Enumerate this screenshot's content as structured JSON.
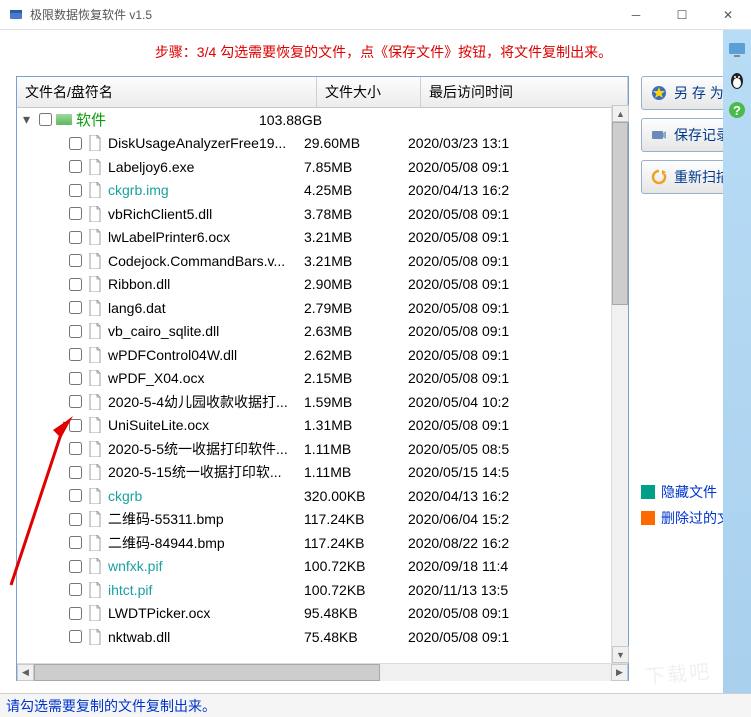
{
  "title": "极限数据恢复软件 v1.5",
  "step_text": "步骤：3/4 勾选需要恢复的文件，点《保存文件》按钮，将文件复制出来。",
  "columns": {
    "name": "文件名/盘符名",
    "size": "文件大小",
    "date": "最后访问时间"
  },
  "root": {
    "name": "软件",
    "size": "103.88GB"
  },
  "files": [
    {
      "name": "DiskUsageAnalyzerFree19...",
      "size": "29.60MB",
      "date": "2020/03/23 13:1",
      "teal": false
    },
    {
      "name": "Labeljoy6.exe",
      "size": "7.85MB",
      "date": "2020/05/08 09:1",
      "teal": false
    },
    {
      "name": "ckgrb.img",
      "size": "4.25MB",
      "date": "2020/04/13 16:2",
      "teal": true
    },
    {
      "name": "vbRichClient5.dll",
      "size": "3.78MB",
      "date": "2020/05/08 09:1",
      "teal": false
    },
    {
      "name": "lwLabelPrinter6.ocx",
      "size": "3.21MB",
      "date": "2020/05/08 09:1",
      "teal": false
    },
    {
      "name": "Codejock.CommandBars.v...",
      "size": "3.21MB",
      "date": "2020/05/08 09:1",
      "teal": false
    },
    {
      "name": "Ribbon.dll",
      "size": "2.90MB",
      "date": "2020/05/08 09:1",
      "teal": false
    },
    {
      "name": "lang6.dat",
      "size": "2.79MB",
      "date": "2020/05/08 09:1",
      "teal": false
    },
    {
      "name": "vb_cairo_sqlite.dll",
      "size": "2.63MB",
      "date": "2020/05/08 09:1",
      "teal": false
    },
    {
      "name": "wPDFControl04W.dll",
      "size": "2.62MB",
      "date": "2020/05/08 09:1",
      "teal": false
    },
    {
      "name": "wPDF_X04.ocx",
      "size": "2.15MB",
      "date": "2020/05/08 09:1",
      "teal": false
    },
    {
      "name": "2020-5-4幼儿园收款收据打...",
      "size": "1.59MB",
      "date": "2020/05/04 10:2",
      "teal": false
    },
    {
      "name": "UniSuiteLite.ocx",
      "size": "1.31MB",
      "date": "2020/05/08 09:1",
      "teal": false
    },
    {
      "name": "2020-5-5统一收据打印软件...",
      "size": "1.11MB",
      "date": "2020/05/05 08:5",
      "teal": false
    },
    {
      "name": "2020-5-15统一收据打印软...",
      "size": "1.11MB",
      "date": "2020/05/15 14:5",
      "teal": false
    },
    {
      "name": "ckgrb",
      "size": "320.00KB",
      "date": "2020/04/13 16:2",
      "teal": true
    },
    {
      "name": "二维码-55311.bmp",
      "size": "117.24KB",
      "date": "2020/06/04 15:2",
      "teal": false
    },
    {
      "name": "二维码-84944.bmp",
      "size": "117.24KB",
      "date": "2020/08/22 16:2",
      "teal": false
    },
    {
      "name": "wnfxk.pif",
      "size": "100.72KB",
      "date": "2020/09/18 11:4",
      "teal": true
    },
    {
      "name": "ihtct.pif",
      "size": "100.72KB",
      "date": "2020/11/13 13:5",
      "teal": true
    },
    {
      "name": "LWDTPicker.ocx",
      "size": "95.48KB",
      "date": "2020/05/08 09:1",
      "teal": false
    },
    {
      "name": "nktwab.dll",
      "size": "75.48KB",
      "date": "2020/05/08 09:1",
      "teal": false
    }
  ],
  "buttons": {
    "save_as": "另 存 为",
    "save_record": "保存记录",
    "rescan": "重新扫描"
  },
  "legend": {
    "hidden": "隐藏文件",
    "deleted": "删除过的文件"
  },
  "legend_colors": {
    "hidden": "#00a088",
    "deleted": "#ff6a00"
  },
  "status": "请勾选需要复制的文件复制出来。",
  "watermark": "下载吧"
}
